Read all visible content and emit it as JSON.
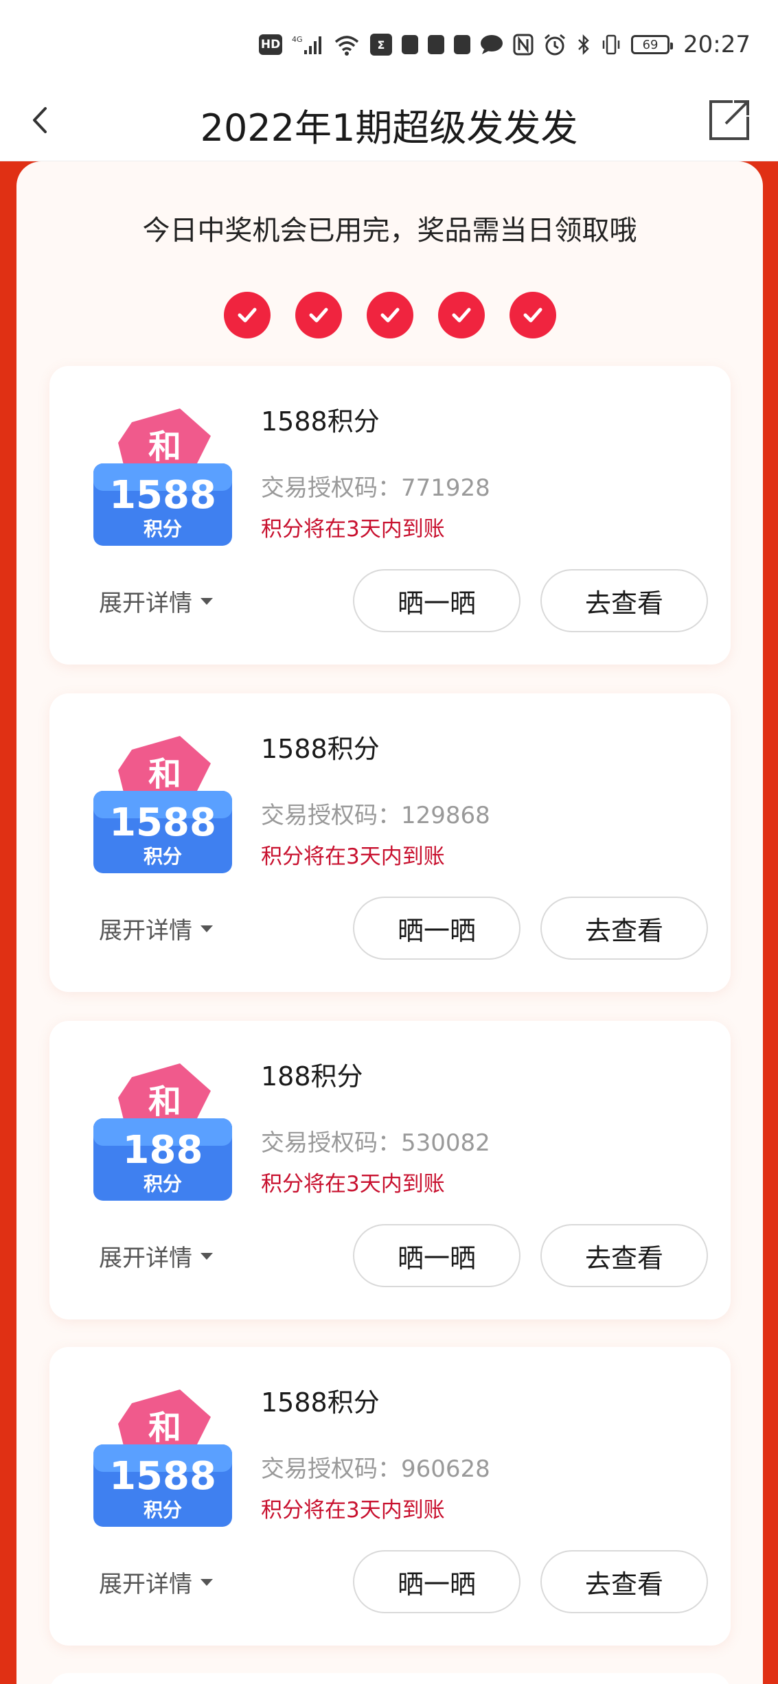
{
  "status_bar": {
    "hd": "HD",
    "network": "4G",
    "battery": "69",
    "time": "20:27"
  },
  "nav": {
    "title": "2022年1期超级发发发"
  },
  "notice": "今日中奖机会已用完，奖品需当日领取哦",
  "checks_count": 5,
  "colors": {
    "accent_red": "#f0243f",
    "frame_red": "#e03014",
    "arrival_text": "#c8102e"
  },
  "labels": {
    "auth_prefix": "交易授权码：",
    "expand": "展开详情",
    "share": "晒一晒",
    "view": "去查看",
    "badge_unit": "积分",
    "badge_tag": "和"
  },
  "prizes": [
    {
      "title": "1588积分",
      "points": "1588",
      "auth_line": "交易授权码：771928",
      "arrival": "积分将在3天内到账"
    },
    {
      "title": "1588积分",
      "points": "1588",
      "auth_line": "交易授权码：129868",
      "arrival": "积分将在3天内到账"
    },
    {
      "title": "188积分",
      "points": "188",
      "auth_line": "交易授权码：530082",
      "arrival": "积分将在3天内到账"
    },
    {
      "title": "1588积分",
      "points": "1588",
      "auth_line": "交易授权码：960628",
      "arrival": "积分将在3天内到账"
    }
  ]
}
